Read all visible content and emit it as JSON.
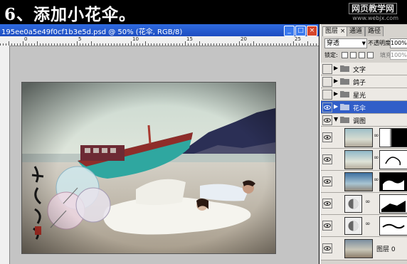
{
  "banner": {
    "title": "6、添加小花伞。",
    "watermark_top": "网页教学网",
    "watermark_bottom": "www.webjx.com"
  },
  "document": {
    "title": "195ee0a5e49f0cf1b3e5d.psd @ 50% (花伞, RGB/8)",
    "ruler_numbers": [
      "0",
      "5",
      "10",
      "15",
      "20",
      "25",
      "30"
    ]
  },
  "layers_panel": {
    "tabs": [
      "图层",
      "通道",
      "路径"
    ],
    "tab_close": "×",
    "blend_mode": "穿透",
    "opacity_label": "不透明度:",
    "opacity_value": "100%",
    "lock_label": "锁定:",
    "fill_label": "填充:",
    "fill_value": "100%",
    "groups": [
      {
        "name": "文字",
        "expanded": false,
        "selected": false
      },
      {
        "name": "鸽子",
        "expanded": false,
        "selected": false
      },
      {
        "name": "星光",
        "expanded": false,
        "selected": false
      },
      {
        "name": "花伞",
        "expanded": false,
        "selected": true
      },
      {
        "name": "调图",
        "expanded": true,
        "selected": false
      }
    ],
    "bottom_layer_name": "图层 0"
  },
  "icons": {
    "eye": "eye-icon",
    "folder": "folder-icon",
    "chain": "chain-link-icon",
    "adjustment": "levels-adjustment-icon"
  },
  "colors": {
    "titlebar": "#1d4cc0",
    "selected_layer": "#315ec8",
    "panel_bg": "#d6d3ce"
  }
}
